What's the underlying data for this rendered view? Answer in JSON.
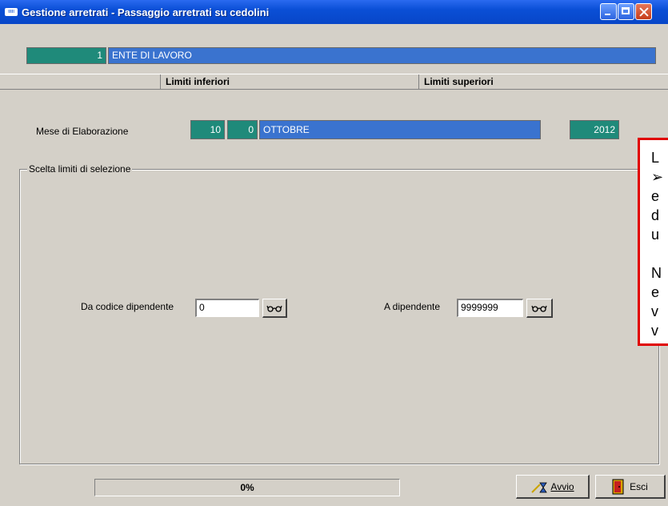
{
  "window": {
    "title": "Gestione arretrati - Passaggio arretrati su cedolini",
    "app_icon_text": "ιιιιι"
  },
  "ente": {
    "code": "1",
    "name": "ENTE DI LAVORO"
  },
  "headers": {
    "lower": "Limiti inferiori",
    "upper": "Limiti superiori"
  },
  "mese": {
    "label": "Mese di Elaborazione",
    "month_num": "10",
    "sub": "0",
    "month_name": "OTTOBRE",
    "year": "2012"
  },
  "selection": {
    "group_label": "Scelta limiti di selezione",
    "from_label": "Da codice dipendente",
    "from_value": "0",
    "to_label": "A dipendente",
    "to_value": "9999999"
  },
  "status": {
    "progress_text": "0%",
    "progress": 0
  },
  "buttons": {
    "start": "Avvio",
    "exit": "Esci"
  },
  "callout": {
    "lines": [
      "L",
      "➢",
      "e",
      "d",
      "u",
      "",
      "N",
      "e",
      "v",
      "v"
    ]
  },
  "colors": {
    "titlebar": "#0a4fd6",
    "lcd_teal": "#1f8a7a",
    "lcd_blue": "#3a73cf",
    "callout_border": "#e00000"
  },
  "icons": {
    "app": "app-icon",
    "lookup": "glasses-icon",
    "start": "hourglass-wand-icon",
    "exit": "exit-door-icon"
  }
}
